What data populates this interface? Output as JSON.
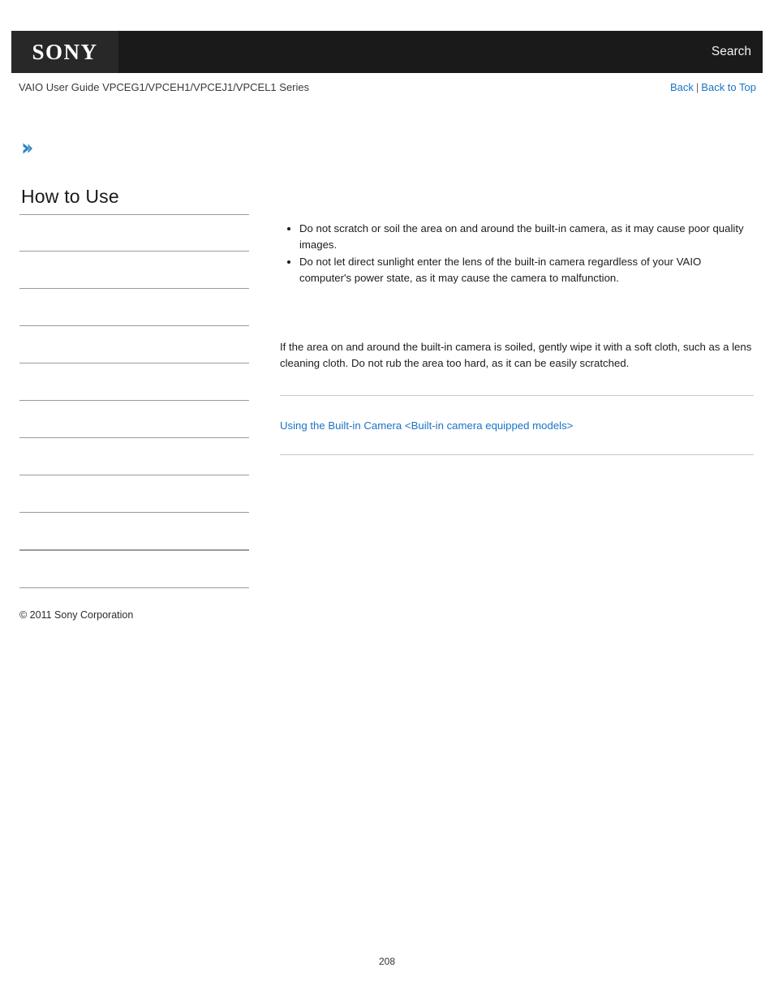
{
  "header": {
    "logo_text": "SONY",
    "search_label": "Search",
    "bar_color": "#1a1a1a",
    "logo_box_color": "#282828"
  },
  "breadcrumb": {
    "title": "VAIO User Guide VPCEG1/VPCEH1/VPCEJ1/VPCEL1 Series",
    "back_label": "Back",
    "separator": "|",
    "back_to_top_label": "Back to Top",
    "link_color": "#1a74c4"
  },
  "marker": {
    "icon": "chevron-right-icon",
    "color": "#2b86c5"
  },
  "sidebar": {
    "heading": "How to Use",
    "items": [
      {
        "label": ""
      },
      {
        "label": ""
      },
      {
        "label": ""
      },
      {
        "label": ""
      },
      {
        "label": ""
      },
      {
        "label": ""
      },
      {
        "label": ""
      },
      {
        "label": ""
      },
      {
        "label": ""
      },
      {
        "label": ""
      }
    ],
    "rule_color": "#9b9b9b"
  },
  "main": {
    "notes": [
      "Do not scratch or soil the area on and around the built-in camera, as it may cause poor quality images.",
      "Do not let direct sunlight enter the lens of the built-in camera regardless of your VAIO computer's power state, as it may cause the camera to malfunction."
    ],
    "paragraph": "If the area on and around the built-in camera is soiled, gently wipe it with a soft cloth, such as a lens cleaning cloth. Do not rub the area too hard, as it can be easily scratched.",
    "related_topic": "Using the Built-in Camera <Built-in camera equipped models>",
    "related_link_color": "#1a74c4"
  },
  "footer": {
    "copyright": "© 2011 Sony Corporation",
    "page_number": "208"
  }
}
